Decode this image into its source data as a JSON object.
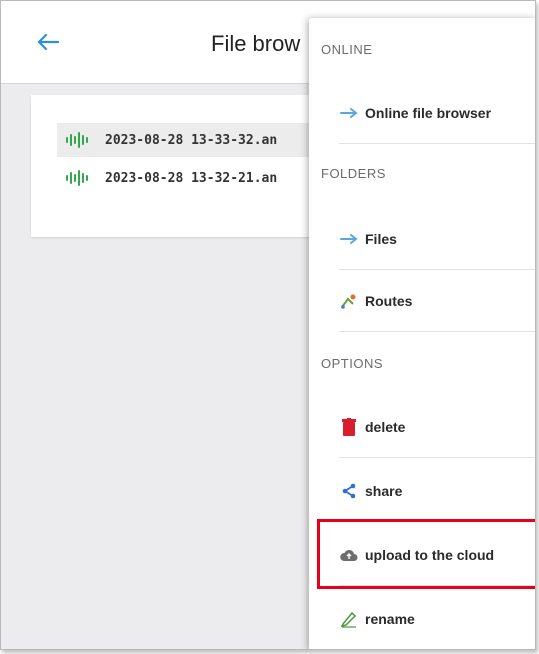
{
  "appbar": {
    "title": "File brow"
  },
  "files": [
    {
      "name": "2023-08-28 13-33-32.an"
    },
    {
      "name": "2023-08-28 13-32-21.an"
    }
  ],
  "menu": {
    "online_header": "ONLINE",
    "online_items": [
      {
        "label": "Online file browser",
        "icon": "double-arrow-icon"
      }
    ],
    "folders_header": "FOLDERS",
    "folder_items": [
      {
        "label": "Files",
        "icon": "double-arrow-icon"
      },
      {
        "label": "Routes",
        "icon": "route-icon"
      }
    ],
    "options_header": "OPTIONS",
    "option_items": [
      {
        "label": "delete",
        "icon": "trash-icon"
      },
      {
        "label": "share",
        "icon": "share-icon"
      },
      {
        "label": "upload to the cloud",
        "icon": "cloud-upload-icon"
      },
      {
        "label": "rename",
        "icon": "pencil-icon"
      }
    ]
  },
  "colors": {
    "accent": "#2f8fd8",
    "wave_green": "#2fa84f",
    "delete_red": "#d81e2c",
    "highlight": "#e8001a"
  }
}
